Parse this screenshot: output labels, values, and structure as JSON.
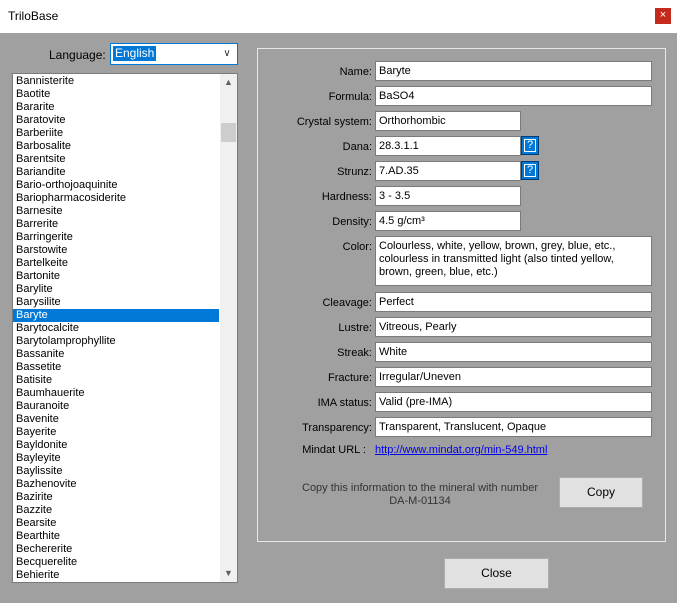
{
  "window": {
    "title": "TriloBase",
    "close_glyph": "×"
  },
  "language": {
    "label": "Language:",
    "value": "English",
    "chevron": "∨"
  },
  "minerals": [
    "Bannisterite",
    "Baotite",
    "Bararite",
    "Baratovite",
    "Barberiite",
    "Barbosalite",
    "Barentsite",
    "Bariandite",
    "Bario-orthojoaquinite",
    "Bariopharmacosiderite",
    "Barnesite",
    "Barrerite",
    "Barringerite",
    "Barstowite",
    "Bartelkeite",
    "Bartonite",
    "Barylite",
    "Barysilite",
    "Baryte",
    "Barytocalcite",
    "Barytolamprophyllite",
    "Bassanite",
    "Bassetite",
    "Batisite",
    "Baumhauerite",
    "Bauranoite",
    "Bavenite",
    "Bayerite",
    "Bayldonite",
    "Bayleyite",
    "Baylissite",
    "Bazhenovite",
    "Bazirite",
    "Bazzite",
    "Bearsite",
    "Bearthite",
    "Bechererite",
    "Becquerelite",
    "Behierite"
  ],
  "selected_mineral": "Baryte",
  "scrollbar": {
    "up_glyph": "▲",
    "down_glyph": "▼"
  },
  "details": {
    "name": {
      "label": "Name:",
      "value": "Baryte"
    },
    "formula": {
      "label": "Formula:",
      "value": "BaSO4"
    },
    "crystal_system": {
      "label": "Crystal system:",
      "value": "Orthorhombic"
    },
    "dana": {
      "label": "Dana:",
      "value": "28.3.1.1",
      "help": "?"
    },
    "strunz": {
      "label": "Strunz:",
      "value": "7.AD.35",
      "help": "?"
    },
    "hardness": {
      "label": "Hardness:",
      "value": "3 - 3.5"
    },
    "density": {
      "label": "Density:",
      "value": "4.5 g/cm³"
    },
    "color": {
      "label": "Color:",
      "value": "Colourless, white, yellow, brown, grey, blue, etc., colourless in transmitted light (also tinted yellow, brown, green, blue, etc.)"
    },
    "cleavage": {
      "label": "Cleavage:",
      "value": "Perfect"
    },
    "lustre": {
      "label": "Lustre:",
      "value": "Vitreous, Pearly"
    },
    "streak": {
      "label": "Streak:",
      "value": "White"
    },
    "fracture": {
      "label": "Fracture:",
      "value": "Irregular/Uneven"
    },
    "ima_status": {
      "label": "IMA status:",
      "value": "Valid (pre-IMA)"
    },
    "transparency": {
      "label": "Transparency:",
      "value": "Transparent, Translucent, Opaque"
    },
    "mindat": {
      "label": "Mindat URL :",
      "value": "http://www.mindat.org/min-549.html"
    }
  },
  "copy": {
    "text": "Copy this information to the mineral with number DA-M-01134",
    "button": "Copy"
  },
  "close_button": "Close"
}
